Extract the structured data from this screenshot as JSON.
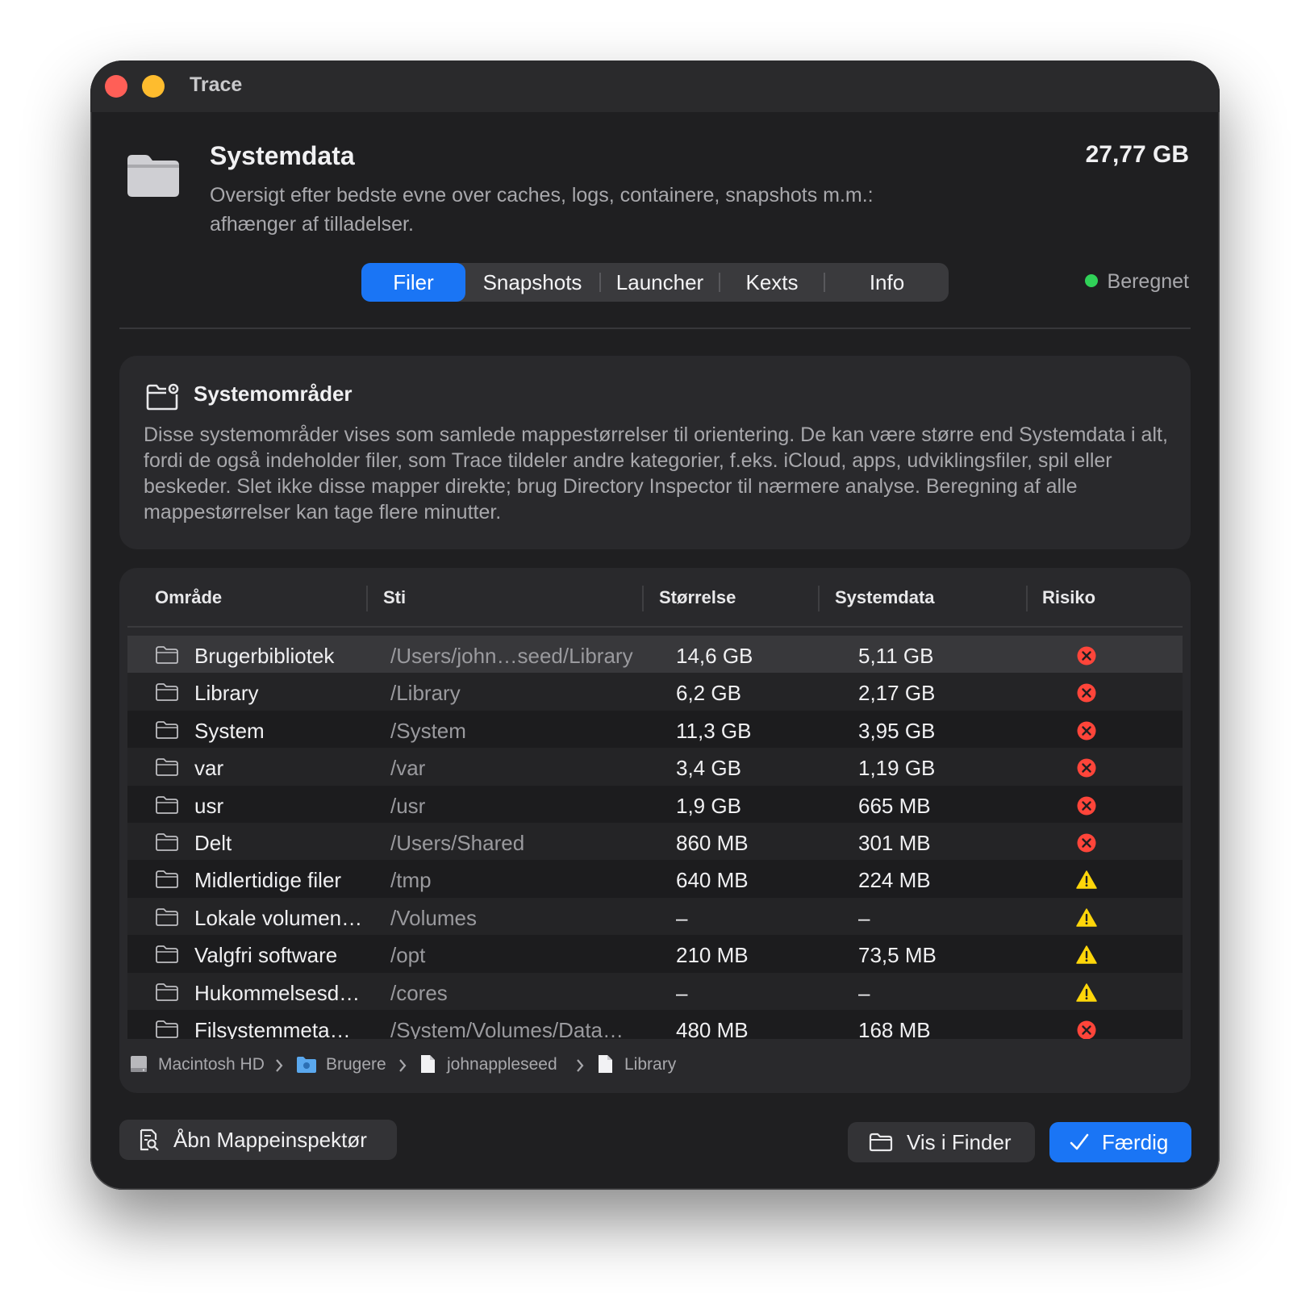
{
  "window": {
    "title": "Trace"
  },
  "header": {
    "title": "Systemdata",
    "subtitle": "Oversigt efter bedste evne over caches, logs, containere, snapshots m.m.: afhænger af tilladelser.",
    "size": "27,77 GB",
    "status": "Beregnet"
  },
  "tabs": [
    {
      "label": "Filer",
      "active": true
    },
    {
      "label": "Snapshots",
      "active": false
    },
    {
      "label": "Launcher",
      "active": false
    },
    {
      "label": "Kexts",
      "active": false
    },
    {
      "label": "Info",
      "active": false
    }
  ],
  "info_card": {
    "title": "Systemområder",
    "text": "Disse systemområder vises som samlede mappestørrelser til orientering. De kan være større end Systemdata i alt, fordi de også indeholder filer, som Trace tildeler andre kategorier, f.eks. iCloud, apps, udviklingsfiler, spil eller beskeder. Slet ikke disse mapper direkte; brug Directory Inspector til nærmere analyse. Beregning af alle mappestørrelser kan tage flere minutter."
  },
  "table": {
    "columns": [
      "Område",
      "Sti",
      "Størrelse",
      "Systemdata",
      "Risiko"
    ],
    "rows": [
      {
        "area": "Brugerbibliotek",
        "path": "/Users/john…seed/Library",
        "size": "14,6 GB",
        "systemdata": "5,11 GB",
        "risk": "high",
        "selected": true
      },
      {
        "area": "Library",
        "path": "/Library",
        "size": "6,2 GB",
        "systemdata": "2,17 GB",
        "risk": "high"
      },
      {
        "area": "System",
        "path": "/System",
        "size": "11,3 GB",
        "systemdata": "3,95 GB",
        "risk": "high"
      },
      {
        "area": "var",
        "path": "/var",
        "size": "3,4 GB",
        "systemdata": "1,19 GB",
        "risk": "high"
      },
      {
        "area": "usr",
        "path": "/usr",
        "size": "1,9 GB",
        "systemdata": "665 MB",
        "risk": "high"
      },
      {
        "area": "Delt",
        "path": "/Users/Shared",
        "size": "860 MB",
        "systemdata": "301 MB",
        "risk": "high"
      },
      {
        "area": "Midlertidige filer",
        "path": "/tmp",
        "size": "640 MB",
        "systemdata": "224 MB",
        "risk": "warning"
      },
      {
        "area": "Lokale volumen…",
        "path": "/Volumes",
        "size": "–",
        "systemdata": "–",
        "risk": "warning"
      },
      {
        "area": "Valgfri software",
        "path": "/opt",
        "size": "210 MB",
        "systemdata": "73,5 MB",
        "risk": "warning"
      },
      {
        "area": "Hukommelsesd…",
        "path": "/cores",
        "size": "–",
        "systemdata": "–",
        "risk": "warning"
      },
      {
        "area": "Filsystemmeta…",
        "path": "/System/Volumes/Data…",
        "size": "480 MB",
        "systemdata": "168 MB",
        "risk": "high"
      }
    ]
  },
  "breadcrumb": [
    {
      "label": "Macintosh HD",
      "icon": "disk-icon"
    },
    {
      "label": "Brugere",
      "icon": "folder-blue-icon"
    },
    {
      "label": "johnappleseed",
      "icon": "document-icon"
    },
    {
      "label": "Library",
      "icon": "document-icon"
    }
  ],
  "buttons": {
    "open_inspector": "Åbn Mappeinspektør",
    "show_in_finder": "Vis i Finder",
    "done": "Færdig"
  },
  "colors": {
    "accent": "#1a75f5",
    "status_ok": "#30d158",
    "risk_high": "#ff453a",
    "risk_warning": "#ffd60a"
  }
}
